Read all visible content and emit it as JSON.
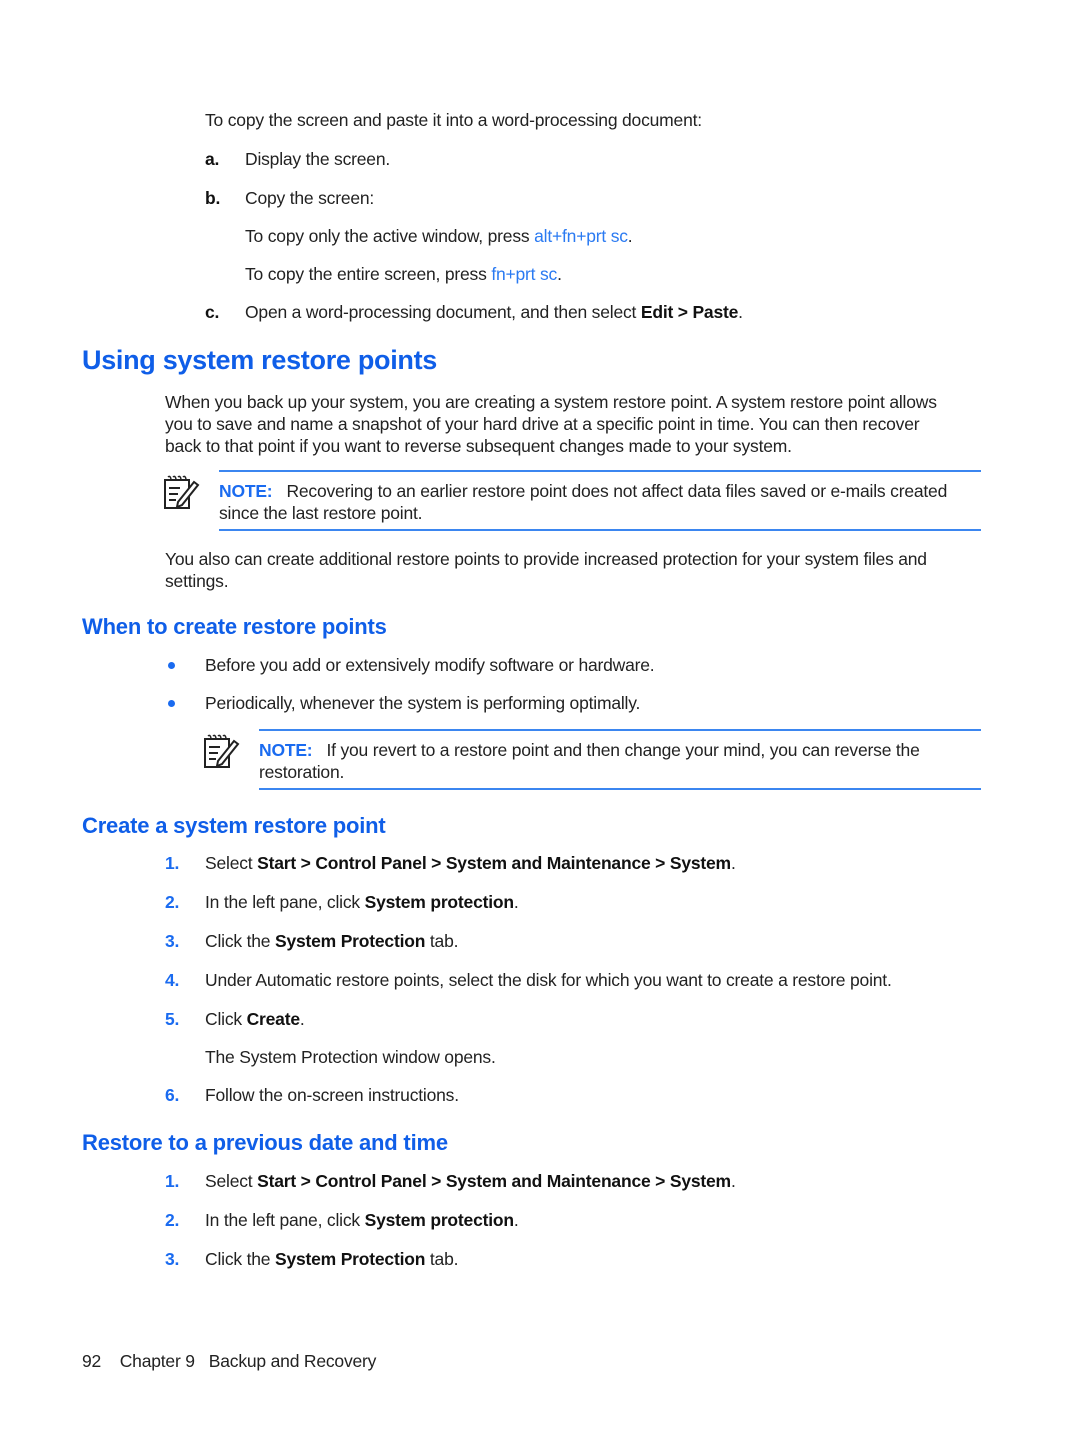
{
  "intro": {
    "lead": "To copy the screen and paste it into a word-processing document:",
    "steps": [
      {
        "label": "a.",
        "text": "Display the screen."
      },
      {
        "label": "b.",
        "text": "Copy the screen:"
      },
      {
        "label": "c.",
        "text_before": "Open a word-processing document, and then select ",
        "bold": "Edit > Paste",
        "text_after": "."
      }
    ],
    "sub": [
      {
        "text": "To copy only the active window, press ",
        "key": "alt+fn+prt sc",
        "after": "."
      },
      {
        "text": "To copy the entire screen, press ",
        "key": "fn+prt sc",
        "after": "."
      }
    ]
  },
  "section": {
    "title": "Using system restore points",
    "para1_lines": [
      "When you back up your system, you are creating a system restore point. A system restore point allows",
      "you to save and name a snapshot of your hard drive at a specific point in time. You can then recover",
      "back to that point if you want to reverse subsequent changes made to your system."
    ],
    "note1": {
      "label": "NOTE:",
      "line1": "Recovering to an earlier restore point does not affect data files saved or e-mails created",
      "line2": "since the last restore point."
    },
    "para2_lines": [
      "You also can create additional restore points to provide increased protection for your system files and",
      "settings."
    ]
  },
  "when": {
    "title": "When to create restore points",
    "bullets": [
      "Before you add or extensively modify software or hardware.",
      "Periodically, whenever the system is performing optimally."
    ],
    "note": {
      "label": "NOTE:",
      "line1": "If you revert to a restore point and then change your mind, you can reverse the",
      "line2": "restoration."
    }
  },
  "create": {
    "title": "Create a system restore point",
    "steps": [
      {
        "num": "1.",
        "pre": "Select ",
        "bold": "Start > Control Panel > System and Maintenance > System",
        "post": "."
      },
      {
        "num": "2.",
        "pre": "In the left pane, click ",
        "bold": "System protection",
        "post": "."
      },
      {
        "num": "3.",
        "pre": "Click the ",
        "bold": "System Protection",
        "post": " tab."
      },
      {
        "num": "4.",
        "pre": "Under Automatic restore points, select the disk for which you want to create a restore point.",
        "bold": "",
        "post": ""
      },
      {
        "num": "5.",
        "pre": "Click ",
        "bold": "Create",
        "post": "."
      },
      {
        "num": "6.",
        "pre": "Follow the on-screen instructions.",
        "bold": "",
        "post": ""
      }
    ],
    "step5_result": "The System Protection window opens."
  },
  "restore": {
    "title": "Restore to a previous date and time",
    "steps": [
      {
        "num": "1.",
        "pre": "Select ",
        "bold": "Start > Control Panel > System and Maintenance > System",
        "post": "."
      },
      {
        "num": "2.",
        "pre": "In the left pane, click ",
        "bold": "System protection",
        "post": "."
      },
      {
        "num": "3.",
        "pre": "Click the ",
        "bold": "System Protection",
        "post": " tab."
      }
    ]
  },
  "footer": {
    "page": "92",
    "chapter": "Chapter 9",
    "title": "Backup and Recovery"
  }
}
